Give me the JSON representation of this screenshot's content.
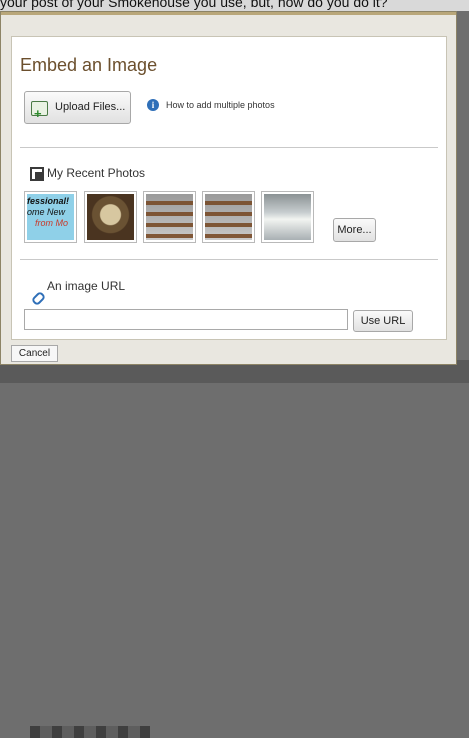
{
  "background": {
    "text": "your post of your Smokehouse you use, but, how do you do it?"
  },
  "dialog": {
    "title": "Embed an Image",
    "upload_button": "Upload Files...",
    "help_link": "How to add multiple photos",
    "recent_photos_label": "My Recent Photos",
    "thumbnails": [
      {
        "lines": [
          "fessional!",
          "ome New",
          "from Mo"
        ]
      },
      {
        "alt": "photo-2"
      },
      {
        "alt": "photo-3"
      },
      {
        "alt": "photo-4"
      },
      {
        "alt": "photo-5"
      }
    ],
    "more_button": "More...",
    "image_url_label": "An image URL",
    "image_url_value": "",
    "use_url_button": "Use URL",
    "cancel_button": "Cancel"
  },
  "colors": {
    "title": "#6b4f2d",
    "dialog_border": "#8d8466",
    "link_blue": "#2f6fb8"
  }
}
